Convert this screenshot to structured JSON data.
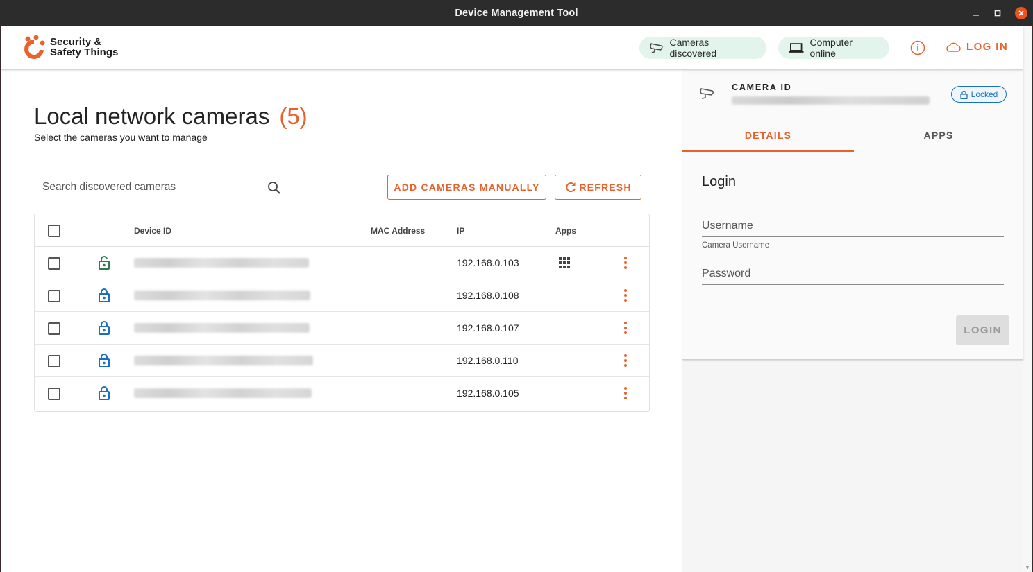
{
  "window": {
    "title": "Device Management Tool"
  },
  "header": {
    "brand_line1": "Security &",
    "brand_line2": "Safety Things",
    "chip_cameras": "Cameras discovered",
    "chip_computer": "Computer online",
    "login_label": "LOG IN",
    "accent_color": "#e8622e",
    "chip_bg": "#e3f4ec"
  },
  "main": {
    "title": "Local network cameras",
    "count": "(5)",
    "subtitle": "Select the cameras you want to manage",
    "search_placeholder": "Search discovered cameras",
    "add_button": "ADD CAMERAS MANUALLY",
    "refresh_button": "REFRESH"
  },
  "table": {
    "headers": {
      "device_id": "Device ID",
      "mac": "MAC Address",
      "ip": "IP",
      "apps": "Apps"
    },
    "rows": [
      {
        "lock_state": "unlocked",
        "lock_color": "#2e7d4f",
        "ip": "192.168.0.103",
        "has_apps": true
      },
      {
        "lock_state": "locked",
        "lock_color": "#1c6fbf",
        "ip": "192.168.0.108",
        "has_apps": false
      },
      {
        "lock_state": "locked",
        "lock_color": "#1c6fbf",
        "ip": "192.168.0.107",
        "has_apps": false
      },
      {
        "lock_state": "locked",
        "lock_color": "#1c6fbf",
        "ip": "192.168.0.110",
        "has_apps": false
      },
      {
        "lock_state": "locked",
        "lock_color": "#1c6fbf",
        "ip": "192.168.0.105",
        "has_apps": false
      }
    ]
  },
  "side_panel": {
    "camera_id_label": "CAMERA ID",
    "locked_badge": "Locked",
    "tabs": [
      {
        "label": "DETAILS",
        "active": true
      },
      {
        "label": "APPS",
        "active": false
      }
    ],
    "login_title": "Login",
    "username_placeholder": "Username",
    "username_helper": "Camera Username",
    "password_placeholder": "Password",
    "login_button": "LOGIN"
  }
}
